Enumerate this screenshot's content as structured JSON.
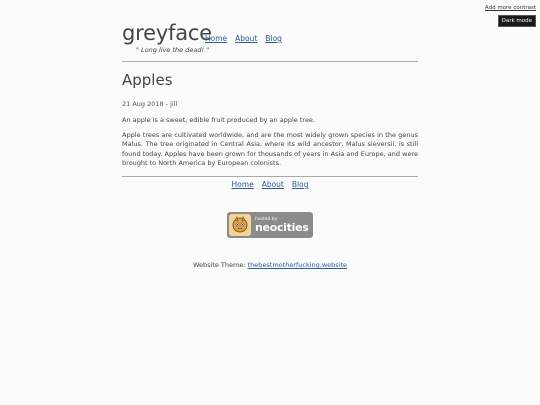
{
  "corner": {
    "contrast_label": "Add more contrast",
    "dark_label": "Dark mode"
  },
  "site": {
    "title": "greyface",
    "tagline": "\" Long live the dead! \""
  },
  "nav": [
    {
      "label": "Home"
    },
    {
      "label": "About"
    },
    {
      "label": "Blog"
    }
  ],
  "post": {
    "title": "Apples",
    "meta": "21 Aug 2018 - jill",
    "paragraphs": [
      "An apple is a sweet, edible fruit produced by an apple tree.",
      "Apple trees are cultivated worldwide, and are the most widely grown species in the genus Malus. The tree originated in Central Asia, where its wild ancestor, Malus sieversii, is still found today. Apples have been grown for thousands of years in Asia and Europe, and were brought to North America by European colonists."
    ]
  },
  "footer_nav": [
    {
      "label": "Home"
    },
    {
      "label": "About"
    },
    {
      "label": "Blog"
    }
  ],
  "badge": {
    "small_text": "hosted by",
    "large_text": "neocities"
  },
  "theme": {
    "label": "Website Theme: ",
    "link": "thebestmotherfucking.website"
  }
}
